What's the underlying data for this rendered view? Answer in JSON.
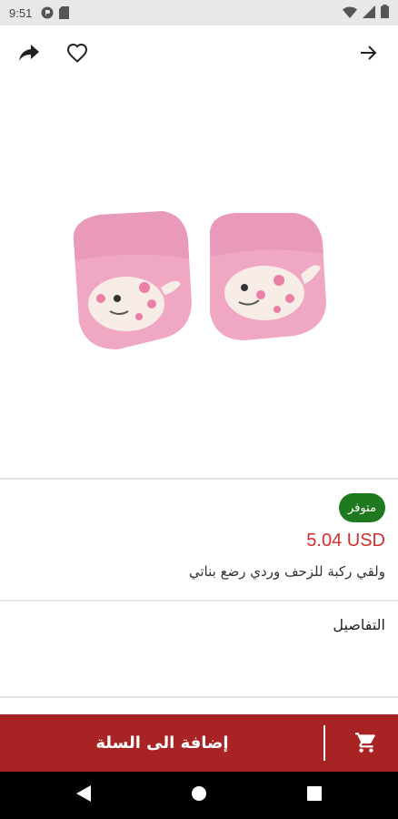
{
  "status_bar": {
    "time": "9:51"
  },
  "product": {
    "availability": "متوفر",
    "price": "5.04 USD",
    "title": "ولقي ركبة للزحف وردي رضع بناتي"
  },
  "details": {
    "label": "التفاصيل"
  },
  "cart": {
    "add_label": "إضافة الى السلة"
  },
  "colors": {
    "accent": "#a82424",
    "price": "#d32f2f",
    "badge": "#1f7a1f"
  },
  "icons": [
    "share-icon",
    "heart-icon",
    "arrow-right-icon",
    "cart-icon",
    "back-triangle-icon",
    "home-circle-icon",
    "recents-square-icon"
  ]
}
